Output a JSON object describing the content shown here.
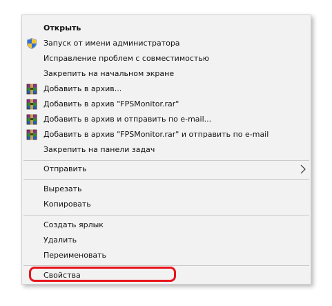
{
  "context_menu": {
    "items": [
      {
        "label": "Открыть",
        "icon": null
      },
      {
        "label": "Запуск от имени администратора",
        "icon": "uac-shield-icon"
      },
      {
        "label": "Исправление проблем с совместимостью",
        "icon": null
      },
      {
        "label": "Закрепить на начальном экране",
        "icon": null
      },
      {
        "label": "Добавить в архив...",
        "icon": "winrar-icon"
      },
      {
        "label": "Добавить в архив \"FPSMonitor.rar\"",
        "icon": "winrar-icon"
      },
      {
        "label": "Добавить в архив и отправить по e-mail...",
        "icon": "winrar-icon"
      },
      {
        "label": "Добавить в архив \"FPSMonitor.rar\" и отправить по e-mail",
        "icon": "winrar-icon"
      },
      {
        "label": "Закрепить на панели задач",
        "icon": null
      },
      {
        "label": "Отправить",
        "icon": "chevron-right-icon"
      },
      {
        "label": "Вырезать",
        "icon": null
      },
      {
        "label": "Копировать",
        "icon": null
      },
      {
        "label": "Создать ярлык",
        "icon": null
      },
      {
        "label": "Удалить",
        "icon": null
      },
      {
        "label": "Переименовать",
        "icon": null
      },
      {
        "label": "Свойства",
        "icon": null
      }
    ]
  },
  "colors": {
    "menu_background": "#f2f2f2",
    "separator": "#c9c9c9",
    "highlight_outline": "#e8131b"
  }
}
